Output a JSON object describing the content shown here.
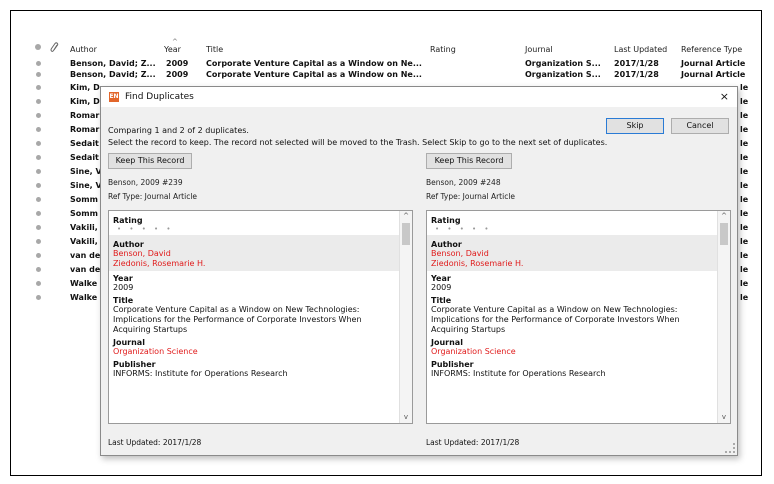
{
  "library": {
    "headers": {
      "author": "Author",
      "year": "Year",
      "title": "Title",
      "rating": "Rating",
      "journal": "Journal",
      "last_updated": "Last Updated",
      "ref_type": "Reference Type"
    },
    "rows": [
      {
        "author": "Benson, David; Z...",
        "year": "2009",
        "title": "Corporate Venture Capital as a Window on Ne...",
        "journal": "Organization S...",
        "last_updated": "2017/1/28",
        "ref_type": "Journal Article"
      },
      {
        "author": "Benson, David; Z...",
        "year": "2009",
        "title": "Corporate Venture Capital as a Window on Ne...",
        "journal": "Organization S...",
        "last_updated": "2017/1/28",
        "ref_type": "Journal Article"
      },
      {
        "author": "Kim, D",
        "ref_type": "le"
      },
      {
        "author": "Kim, D",
        "ref_type": "le"
      },
      {
        "author": "Romar",
        "ref_type": "le"
      },
      {
        "author": "Romar",
        "ref_type": "le"
      },
      {
        "author": "Sedait",
        "ref_type": "le"
      },
      {
        "author": "Sedait",
        "ref_type": "le"
      },
      {
        "author": "Sine, V",
        "ref_type": "le"
      },
      {
        "author": "Sine, V",
        "ref_type": "le"
      },
      {
        "author": "Somm",
        "ref_type": "le"
      },
      {
        "author": "Somm",
        "ref_type": "le"
      },
      {
        "author": "Vakili,",
        "ref_type": "le"
      },
      {
        "author": "Vakili,",
        "ref_type": "le"
      },
      {
        "author": "van de",
        "ref_type": "le"
      },
      {
        "author": "van de",
        "ref_type": "le"
      },
      {
        "author": "Walke",
        "ref_type": "le"
      },
      {
        "author": "Walke",
        "ref_type": "le"
      }
    ]
  },
  "dialog": {
    "title": "Find Duplicates",
    "icon_text": "EN",
    "close": "×",
    "comparing": "Comparing 1 and 2 of 2 duplicates.",
    "instructions": "Select the record to keep. The record not selected will be moved to the Trash. Select Skip to go to the next set of duplicates.",
    "skip": "Skip",
    "cancel": "Cancel",
    "records": [
      {
        "keep": "Keep This Record",
        "id": "Benson, 2009 #239",
        "ref_type": "Ref Type: Journal Article",
        "rating_label": "Rating",
        "rating": "• • • • •",
        "author_label": "Author",
        "authors": [
          "Benson, David",
          "Ziedonis, Rosemarie H."
        ],
        "year_label": "Year",
        "year": "2009",
        "title_label": "Title",
        "title": "Corporate Venture Capital as a Window on New Technologies: Implications for the Performance of Corporate Investors When Acquiring Startups",
        "journal_label": "Journal",
        "journal": "Organization Science",
        "publisher_label": "Publisher",
        "publisher": "INFORMS: Institute for Operations Research",
        "last_updated": "Last Updated: 2017/1/28"
      },
      {
        "keep": "Keep This Record",
        "id": "Benson, 2009 #248",
        "ref_type": "Ref Type: Journal Article",
        "rating_label": "Rating",
        "rating": "• • • • •",
        "author_label": "Author",
        "authors": [
          "Benson, David",
          "Ziedonis, Rosemarie H."
        ],
        "year_label": "Year",
        "year": "2009",
        "title_label": "Title",
        "title": "Corporate Venture Capital as a Window on New Technologies: Implications for the Performance of Corporate Investors When Acquiring Startups",
        "journal_label": "Journal",
        "journal": "Organization Science",
        "publisher_label": "Publisher",
        "publisher": "INFORMS: Institute for Operations Research",
        "last_updated": "Last Updated: 2017/1/28"
      }
    ]
  },
  "colors": {
    "accent_red": "#e01b1b",
    "icon_orange": "#e2662b",
    "focus_blue": "#2a7bd5"
  },
  "icons": {
    "paperclip": "paperclip-icon",
    "sort": "sort-arrow-icon"
  }
}
